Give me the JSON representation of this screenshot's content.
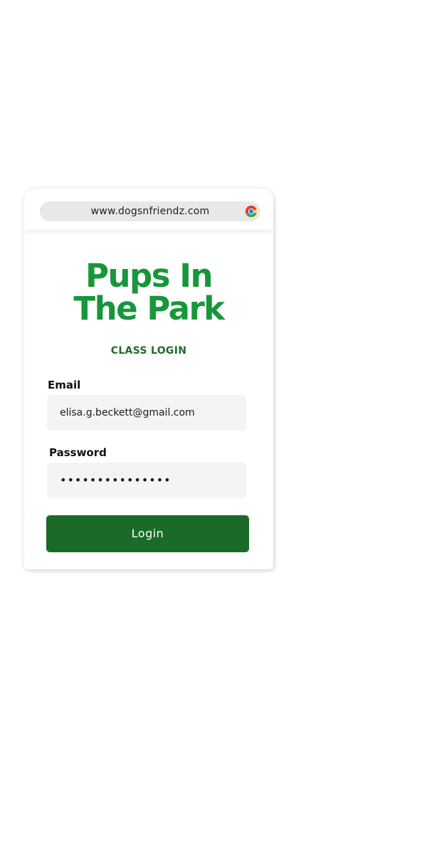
{
  "browser": {
    "url": "www.dogsnfriendz.com",
    "browser_icon": "chrome-icon"
  },
  "brand": {
    "line1": "Pups In",
    "line2": "The Park",
    "color": "#17973a"
  },
  "form": {
    "title": "CLASS LOGIN",
    "email_label": "Email",
    "email_value": "elisa.g.beckett@gmail.com",
    "password_label": "Password",
    "password_value": "•••••••••••••••",
    "submit_label": "Login",
    "button_color": "#1b6b28"
  }
}
